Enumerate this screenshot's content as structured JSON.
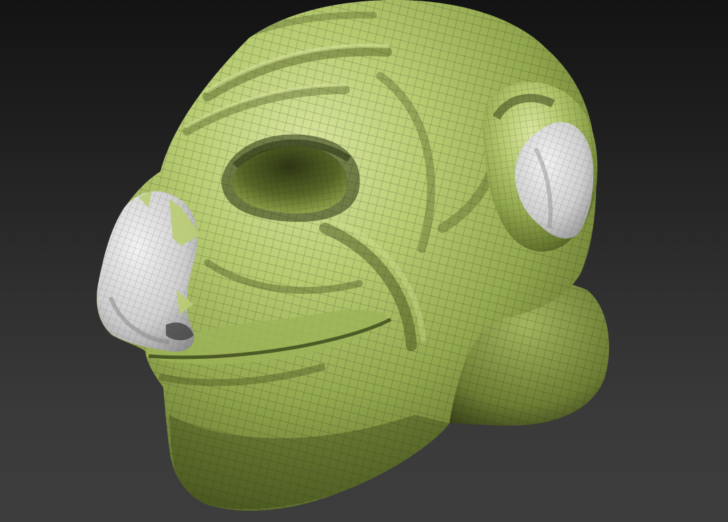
{
  "viewport": {
    "background_top": "#131313",
    "background_bottom": "#3d3d3d"
  },
  "model": {
    "subject": "sculpted-creature-head",
    "base_color": "#a9bd63",
    "highlight_color": "#d4e39a",
    "shadow_color": "#3f4a1c",
    "masked_color": "#dcdcdc",
    "wireframe_color": "#1c2410",
    "wireframe": true,
    "masked_regions": [
      "nose-tip",
      "ear-inner"
    ]
  }
}
